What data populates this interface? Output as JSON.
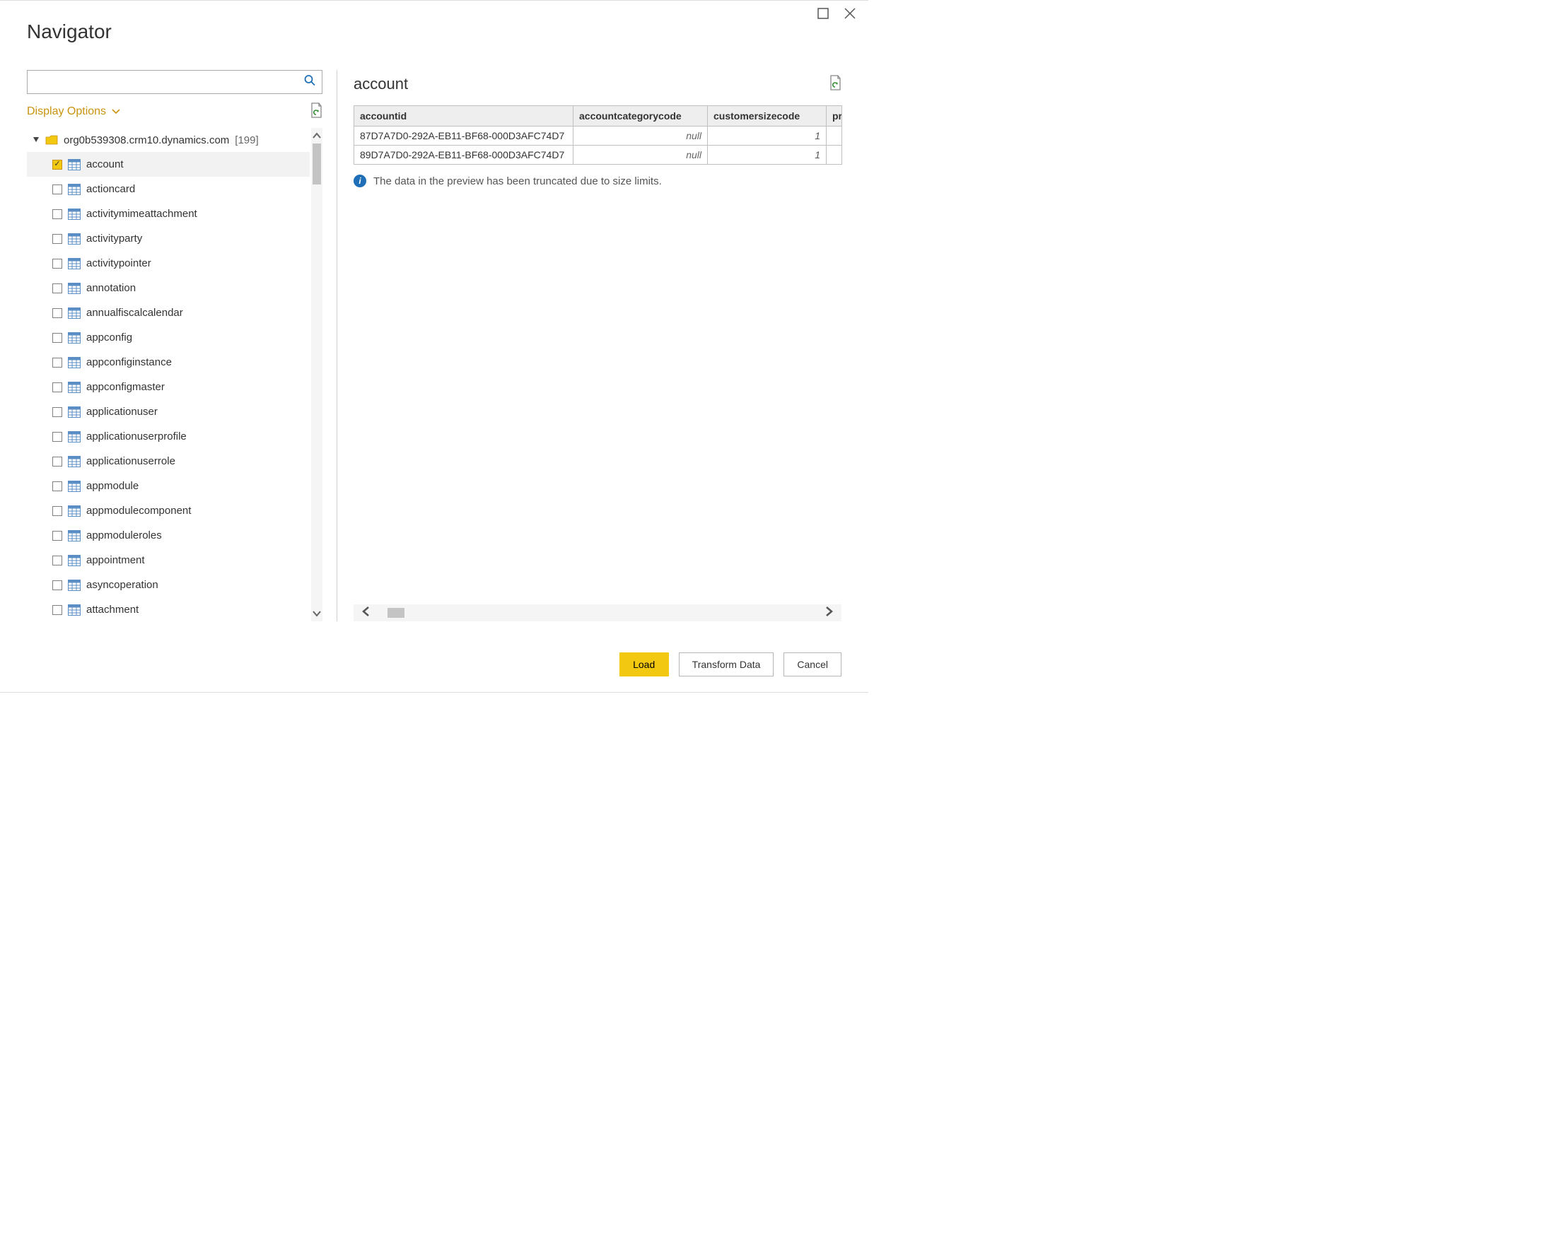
{
  "window": {
    "title": "Navigator"
  },
  "search": {
    "placeholder": ""
  },
  "displayOptions": {
    "label": "Display Options"
  },
  "tree": {
    "root": {
      "label": "org0b539308.crm10.dynamics.com",
      "count": "[199]"
    },
    "items": [
      {
        "label": "account",
        "checked": true,
        "selected": true
      },
      {
        "label": "actioncard",
        "checked": false
      },
      {
        "label": "activitymimeattachment",
        "checked": false
      },
      {
        "label": "activityparty",
        "checked": false
      },
      {
        "label": "activitypointer",
        "checked": false
      },
      {
        "label": "annotation",
        "checked": false
      },
      {
        "label": "annualfiscalcalendar",
        "checked": false
      },
      {
        "label": "appconfig",
        "checked": false
      },
      {
        "label": "appconfiginstance",
        "checked": false
      },
      {
        "label": "appconfigmaster",
        "checked": false
      },
      {
        "label": "applicationuser",
        "checked": false
      },
      {
        "label": "applicationuserprofile",
        "checked": false
      },
      {
        "label": "applicationuserrole",
        "checked": false
      },
      {
        "label": "appmodule",
        "checked": false
      },
      {
        "label": "appmodulecomponent",
        "checked": false
      },
      {
        "label": "appmoduleroles",
        "checked": false
      },
      {
        "label": "appointment",
        "checked": false
      },
      {
        "label": "asyncoperation",
        "checked": false
      },
      {
        "label": "attachment",
        "checked": false
      }
    ]
  },
  "preview": {
    "title": "account",
    "columns": [
      "accountid",
      "accountcategorycode",
      "customersizecode",
      "pr"
    ],
    "rows": [
      {
        "accountid": "87D7A7D0-292A-EB11-BF68-000D3AFC74D7",
        "accountcategorycode": "null",
        "customersizecode": "1"
      },
      {
        "accountid": "89D7A7D0-292A-EB11-BF68-000D3AFC74D7",
        "accountcategorycode": "null",
        "customersizecode": "1"
      }
    ],
    "infoMessage": "The data in the preview has been truncated due to size limits."
  },
  "footer": {
    "load": "Load",
    "transform": "Transform Data",
    "cancel": "Cancel"
  }
}
